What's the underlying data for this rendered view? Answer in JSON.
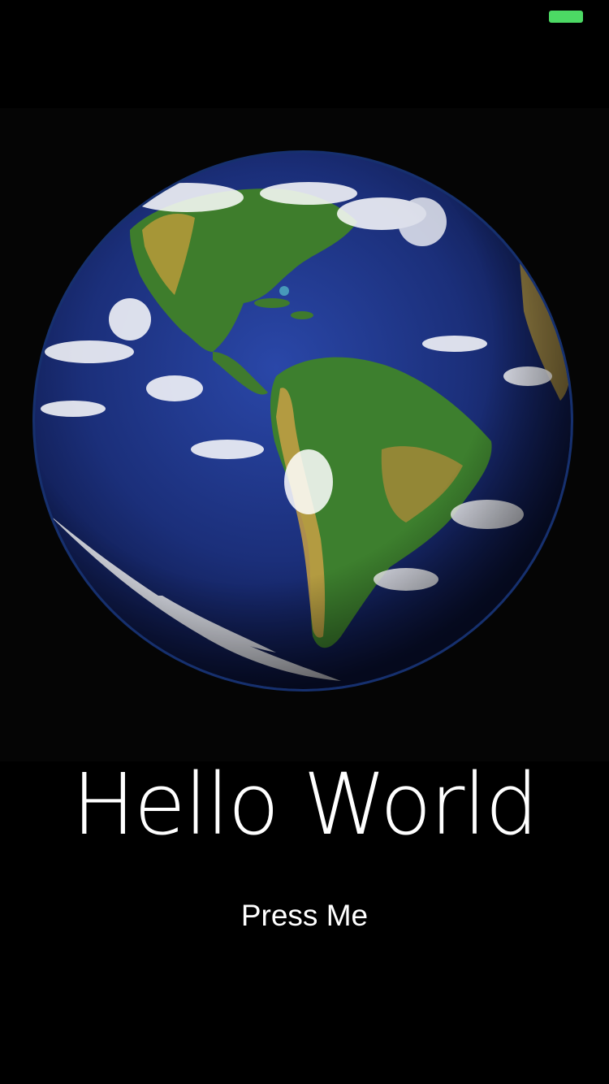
{
  "status_bar": {
    "battery_color": "#4cd964",
    "battery_icon": "battery-icon"
  },
  "hero_image": {
    "icon": "earth-globe-image",
    "ocean_color": "#1b2f7a",
    "land_color": "#3e7d2c",
    "background_color": "#050505"
  },
  "main": {
    "title": "Hello World",
    "button_label": "Press Me"
  }
}
